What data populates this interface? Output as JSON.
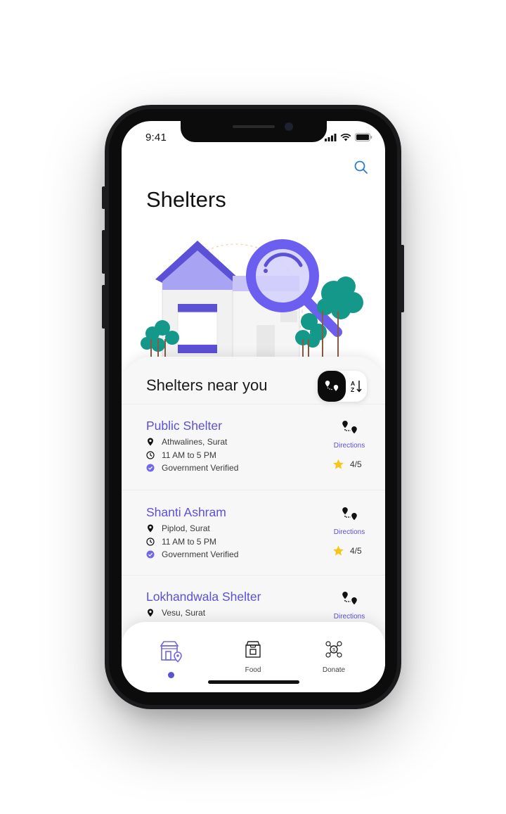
{
  "status_bar": {
    "time": "9:41"
  },
  "header": {
    "title": "Shelters",
    "search_icon": "search-icon"
  },
  "sheet": {
    "title": "Shelters near you",
    "toggle": {
      "active": "map-route-icon",
      "inactive": "sort-az-icon"
    }
  },
  "shelters": [
    {
      "name": "Public Shelter",
      "address": "Athwalines, Surat",
      "hours": "11 AM to 5 PM",
      "verified": "Government Verified",
      "directions": "Directions",
      "rating": "4/5"
    },
    {
      "name": "Shanti Ashram",
      "address": "Piplod, Surat",
      "hours": "11 AM to 5 PM",
      "verified": "Government Verified",
      "directions": "Directions",
      "rating": "4/5"
    },
    {
      "name": "Lokhandwala Shelter",
      "address": "Vesu, Surat",
      "directions": "Directions"
    }
  ],
  "tabbar": {
    "tabs": [
      {
        "label": "",
        "icon": "shelter-location-icon",
        "active": true
      },
      {
        "label": "Food",
        "icon": "food-bag-icon"
      },
      {
        "label": "Donate",
        "icon": "donate-coins-icon"
      }
    ]
  },
  "colors": {
    "accent": "#5b50d6",
    "accent_light": "#a9a3f3",
    "tree": "#13988a",
    "star": "#f5c518"
  }
}
